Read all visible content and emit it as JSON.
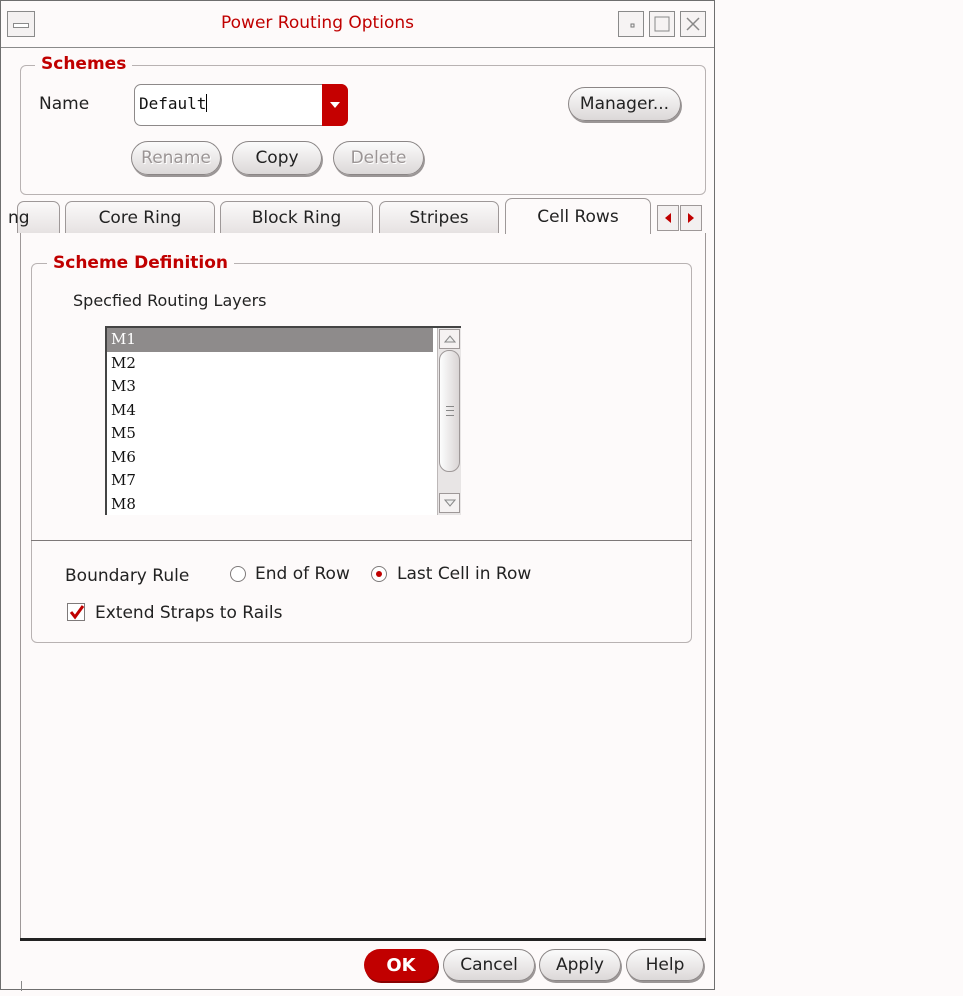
{
  "window": {
    "title": "Power Routing Options"
  },
  "schemes": {
    "legend": "Schemes",
    "name_label": "Name",
    "name_value": "Default",
    "manager_label": "Manager...",
    "rename_label": "Rename",
    "copy_label": "Copy",
    "delete_label": "Delete"
  },
  "tabs": [
    {
      "label": "ng",
      "active": false
    },
    {
      "label": "Core Ring",
      "active": false
    },
    {
      "label": "Block Ring",
      "active": false
    },
    {
      "label": "Stripes",
      "active": false
    },
    {
      "label": "Cell Rows",
      "active": true
    }
  ],
  "scheme_definition": {
    "legend": "Scheme Definition",
    "layers_label": "Specfied Routing Layers",
    "layers": [
      "M1",
      "M2",
      "M3",
      "M4",
      "M5",
      "M6",
      "M7",
      "M8"
    ],
    "selected_layer": "M1",
    "boundary_rule_label": "Boundary Rule",
    "boundary_options": [
      {
        "label": "End of Row",
        "selected": false
      },
      {
        "label": "Last Cell in Row",
        "selected": true
      }
    ],
    "extend_straps_label": "Extend Straps to Rails",
    "extend_straps_checked": true
  },
  "footer": {
    "ok_label": "OK",
    "cancel_label": "Cancel",
    "apply_label": "Apply",
    "help_label": "Help"
  },
  "colors": {
    "accent": "#c00000",
    "selection": "#8e8b8b",
    "background": "#fdfafa"
  },
  "icons": {
    "window_menu": "window-menu-icon",
    "minimize": "minimize-icon",
    "maximize": "maximize-icon",
    "close": "close-icon",
    "dropdown": "chevron-down-icon",
    "tab_left": "arrow-left-icon",
    "tab_right": "arrow-right-icon",
    "scroll_up": "scroll-up-icon",
    "scroll_down": "scroll-down-icon",
    "checkmark": "checkmark-icon"
  }
}
